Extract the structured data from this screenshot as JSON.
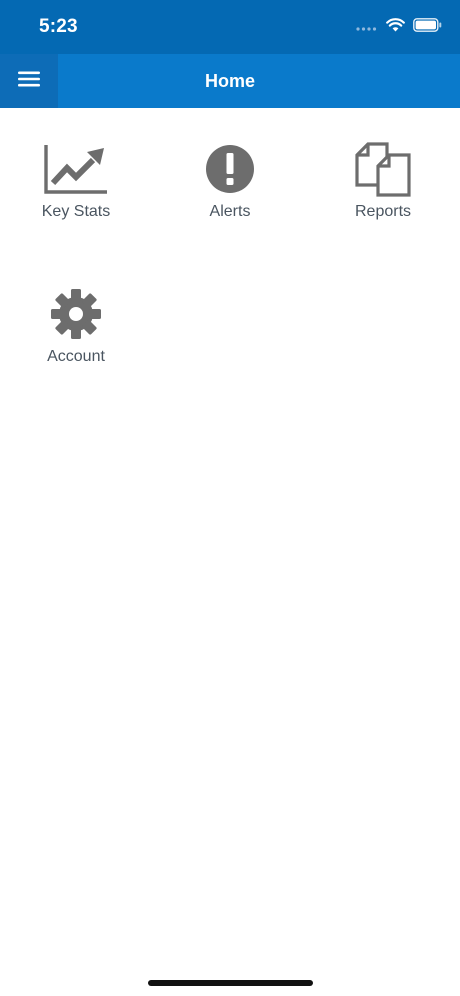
{
  "status_bar": {
    "time": "5:23"
  },
  "nav": {
    "title": "Home",
    "menu_icon": "hamburger-menu-icon"
  },
  "colors": {
    "status_bar_bg": "#0469b3",
    "nav_bg": "#0a7acb",
    "icon_gray": "#6d6d6d",
    "label_gray": "#4a5560"
  },
  "tiles": [
    {
      "label": "Key Stats",
      "icon": "trending-chart-icon"
    },
    {
      "label": "Alerts",
      "icon": "alert-circle-icon"
    },
    {
      "label": "Reports",
      "icon": "documents-icon"
    },
    {
      "label": "Account",
      "icon": "gear-icon"
    }
  ]
}
